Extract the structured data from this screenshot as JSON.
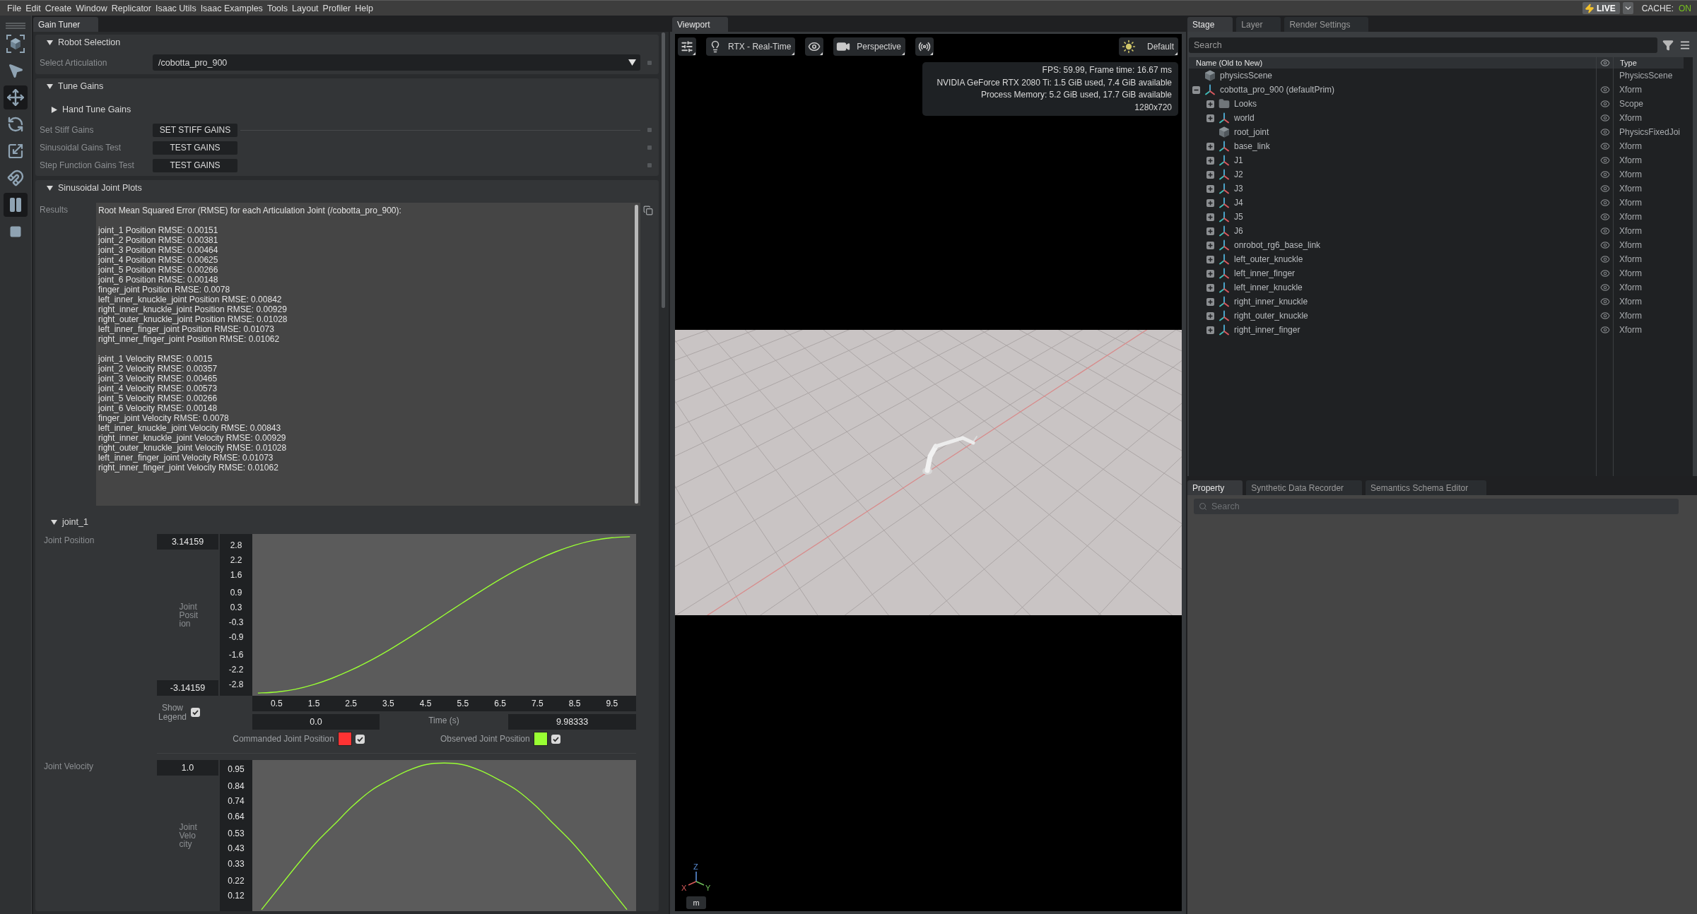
{
  "menu_bar": {
    "items": [
      "File",
      "Edit",
      "Create",
      "Window",
      "Replicator",
      "Isaac Utils",
      "Isaac Examples",
      "Tools",
      "Layout",
      "Profiler",
      "Help"
    ],
    "live_button": {
      "label": "LIVE"
    },
    "cache": {
      "label": "CACHE:",
      "value": "ON",
      "on": true
    }
  },
  "tool_bar": {
    "tools": [
      {
        "kind": "select",
        "selected": false
      },
      {
        "kind": "pointer",
        "selected": false
      },
      {
        "kind": "move",
        "selected": true
      },
      {
        "kind": "rotate",
        "selected": false
      },
      {
        "kind": "scale",
        "selected": false
      },
      {
        "kind": "snap",
        "selected": false
      },
      {
        "kind": "pause",
        "selected": true
      },
      {
        "kind": "stop",
        "selected": false
      }
    ]
  },
  "gain_tuner": {
    "tab": {
      "label": "Gain Tuner",
      "selected": true
    },
    "robot_selection": {
      "title": "Robot Selection",
      "expanded": true,
      "field_label": "Select Articulation",
      "value": "/cobotta_pro_900"
    },
    "tune_gains": {
      "title": "Tune Gains",
      "expanded": true,
      "hand_tune": {
        "title": "Hand Tune Gains",
        "expanded": false
      },
      "rows": [
        {
          "label": "Set Stiff Gains",
          "button": "SET STIFF GAINS",
          "divider": true
        },
        {
          "label": "Sinusoidal Gains Test",
          "button": "TEST GAINS",
          "divider": false
        },
        {
          "label": "Step Function Gains Test",
          "button": "TEST GAINS",
          "divider": false
        }
      ]
    },
    "joint_plots": {
      "title": "Sinusoidal Joint Plots",
      "expanded": true,
      "results": {
        "label": "Results",
        "heading": "Root Mean Squared Error (RMSE) for each Articulation Joint (/cobotta_pro_900):",
        "groups": [
          [
            "joint_1 Position RMSE: 0.00151",
            "joint_2 Position RMSE: 0.00381",
            "joint_3 Position RMSE: 0.00464",
            "joint_4 Position RMSE: 0.00625",
            "joint_5 Position RMSE: 0.00266",
            "joint_6 Position RMSE: 0.00148",
            "finger_joint Position RMSE: 0.0078",
            "left_inner_knuckle_joint Position RMSE: 0.00842",
            "right_inner_knuckle_joint Position RMSE: 0.00929",
            "right_outer_knuckle_joint Position RMSE: 0.01028",
            "left_inner_finger_joint Position RMSE: 0.01073",
            "right_inner_finger_joint Position RMSE: 0.01062"
          ],
          [
            "joint_1 Velocity RMSE: 0.0015",
            "joint_2 Velocity RMSE: 0.00357",
            "joint_3 Velocity RMSE: 0.00465",
            "joint_4 Velocity RMSE: 0.00573",
            "joint_5 Velocity RMSE: 0.00266",
            "joint_6 Velocity RMSE: 0.00148",
            "finger_joint Velocity RMSE: 0.0078",
            "left_inner_knuckle_joint Velocity RMSE: 0.00843",
            "right_inner_knuckle_joint Velocity RMSE: 0.00929",
            "right_outer_knuckle_joint Velocity RMSE: 0.01028",
            "left_inner_finger_joint Velocity RMSE: 0.01073",
            "right_inner_finger_joint Velocity RMSE: 0.01062"
          ]
        ]
      },
      "joint": {
        "title": "joint_1",
        "expanded": true,
        "plots": [
          {
            "label": "Joint Position",
            "axis_label": "Joint Position",
            "y_max": "3.14159",
            "y_min": "-3.14159",
            "x_min": "0.0",
            "x_title": "Time (s)",
            "x_max": "9.98333",
            "show_legend": {
              "label": "Show Legend",
              "checked": true
            },
            "legend_toggles": [
              {
                "checked": true
              },
              {
                "checked": true
              }
            ],
            "chart_data": {
              "type": "line",
              "x": [
                0,
                0.5,
                1,
                1.5,
                2,
                2.5,
                3,
                3.5,
                4,
                4.5,
                5,
                5.5,
                6,
                6.5,
                7,
                7.5,
                8,
                8.5,
                9,
                9.5,
                9.98333
              ],
              "series": [
                {
                  "name": "Commanded Joint Position",
                  "color": "#ff3333",
                  "values": [
                    null,
                    null,
                    null,
                    null,
                    null,
                    null,
                    null,
                    null,
                    null,
                    null,
                    null,
                    null,
                    null,
                    null,
                    null,
                    null,
                    null,
                    null,
                    null,
                    null,
                    null
                  ]
                },
                {
                  "name": "Observed Joint Position",
                  "color": "#99ff33",
                  "values": [
                    -3.14,
                    -3.1,
                    -2.99,
                    -2.8,
                    -2.54,
                    -2.22,
                    -1.85,
                    -1.43,
                    -0.97,
                    -0.49,
                    0,
                    0.49,
                    0.97,
                    1.43,
                    1.85,
                    2.22,
                    2.54,
                    2.8,
                    2.99,
                    3.1,
                    3.14
                  ]
                }
              ],
              "xlim": [
                -0.15,
                10.15
              ],
              "ylim": [
                -3.25,
                3.25
              ],
              "xticks": [
                0.5,
                1.5,
                2.5,
                3.5,
                4.5,
                5.5,
                6.5,
                7.5,
                8.5,
                9.5
              ],
              "yticks": [
                2.8,
                2.2,
                1.6,
                0.9,
                0.3,
                -0.3,
                -0.9,
                -1.6,
                -2.2,
                -2.8
              ],
              "legend": "bottom"
            }
          },
          {
            "label": "Joint Velocity",
            "axis_label": "Joint Velocity",
            "y_max": "1.0",
            "chart_data": {
              "type": "line",
              "series": [
                {
                  "color": "#99ff33",
                  "values": [
                    0.03,
                    0.18,
                    0.33,
                    0.47,
                    0.59,
                    0.71,
                    0.81,
                    0.88,
                    0.94,
                    0.98,
                    0.99,
                    0.98,
                    0.94,
                    0.88,
                    0.81,
                    0.71,
                    0.59,
                    0.47,
                    0.33,
                    0.18,
                    0.03
                  ]
                }
              ],
              "ylim": [
                0.02,
                1.01
              ],
              "yticks": [
                0.95,
                0.84,
                0.74,
                0.64,
                0.53,
                0.43,
                0.33,
                0.22,
                0.12
              ]
            }
          }
        ]
      }
    }
  },
  "viewport": {
    "tab": {
      "label": "Viewport",
      "selected": true
    },
    "toolbar": [
      {
        "kind": "settings"
      },
      {
        "kind": "renderer",
        "label": "RTX - Real-Time"
      },
      {
        "kind": "visibility"
      },
      {
        "kind": "camera",
        "label": "Perspective"
      },
      {
        "kind": "broadcast"
      }
    ],
    "lighting": {
      "kind": "lighting",
      "label": "Default"
    },
    "stats": [
      "FPS: 59.99, Frame time: 16.67 ms",
      "NVIDIA GeForce RTX 2080 Ti: 1.5 GiB used, 7.4 GiB available",
      "Process Memory: 5.2 GiB used, 17.7 GiB available",
      "1280x720"
    ],
    "axes": {
      "z": "Z",
      "x": "X",
      "y": "Y"
    },
    "units_button": "m"
  },
  "stage": {
    "tabs": [
      {
        "label": "Stage",
        "selected": true
      },
      {
        "label": "Layer",
        "selected": false
      },
      {
        "label": "Render Settings",
        "selected": false
      }
    ],
    "search": {
      "placeholder": "Search"
    },
    "columns": {
      "name": "Name (Old to New)",
      "type": "Type"
    },
    "tree": [
      {
        "name": "physicsScene",
        "type": "PhysicsScene",
        "kind": "cube",
        "visible": false
      },
      {
        "name": "cobotta_pro_900 (defaultPrim)",
        "type": "Xform",
        "kind": "xform",
        "visible": true,
        "expanded": true,
        "children": [
          {
            "name": "Looks",
            "type": "Scope",
            "kind": "folder",
            "visible": true,
            "expanded": false
          },
          {
            "name": "world",
            "type": "Xform",
            "kind": "xform",
            "visible": true,
            "expanded": false
          },
          {
            "name": "root_joint",
            "type": "PhysicsFixedJoi",
            "kind": "cube",
            "visible": true
          },
          {
            "name": "base_link",
            "type": "Xform",
            "kind": "xform",
            "visible": true,
            "expanded": false
          },
          {
            "name": "J1",
            "type": "Xform",
            "kind": "xform",
            "visible": true,
            "expanded": false
          },
          {
            "name": "J2",
            "type": "Xform",
            "kind": "xform",
            "visible": true,
            "expanded": false
          },
          {
            "name": "J3",
            "type": "Xform",
            "kind": "xform",
            "visible": true,
            "expanded": false
          },
          {
            "name": "J4",
            "type": "Xform",
            "kind": "xform",
            "visible": true,
            "expanded": false
          },
          {
            "name": "J5",
            "type": "Xform",
            "kind": "xform",
            "visible": true,
            "expanded": false
          },
          {
            "name": "J6",
            "type": "Xform",
            "kind": "xform",
            "visible": true,
            "expanded": false
          },
          {
            "name": "onrobot_rg6_base_link",
            "type": "Xform",
            "kind": "xform",
            "visible": true,
            "expanded": false
          },
          {
            "name": "left_outer_knuckle",
            "type": "Xform",
            "kind": "xform",
            "visible": true,
            "expanded": false
          },
          {
            "name": "left_inner_finger",
            "type": "Xform",
            "kind": "xform",
            "visible": true,
            "expanded": false
          },
          {
            "name": "left_inner_knuckle",
            "type": "Xform",
            "kind": "xform",
            "visible": true,
            "expanded": false
          },
          {
            "name": "right_inner_knuckle",
            "type": "Xform",
            "kind": "xform",
            "visible": true,
            "expanded": false
          },
          {
            "name": "right_outer_knuckle",
            "type": "Xform",
            "kind": "xform",
            "visible": true,
            "expanded": false
          },
          {
            "name": "right_inner_finger",
            "type": "Xform",
            "kind": "xform",
            "visible": true,
            "expanded": false
          }
        ]
      }
    ]
  },
  "property": {
    "tabs": [
      {
        "label": "Property",
        "selected": true
      },
      {
        "label": "Synthetic Data Recorder",
        "selected": false
      },
      {
        "label": "Semantics Schema Editor",
        "selected": false
      }
    ],
    "search": {
      "placeholder": "Search"
    }
  }
}
